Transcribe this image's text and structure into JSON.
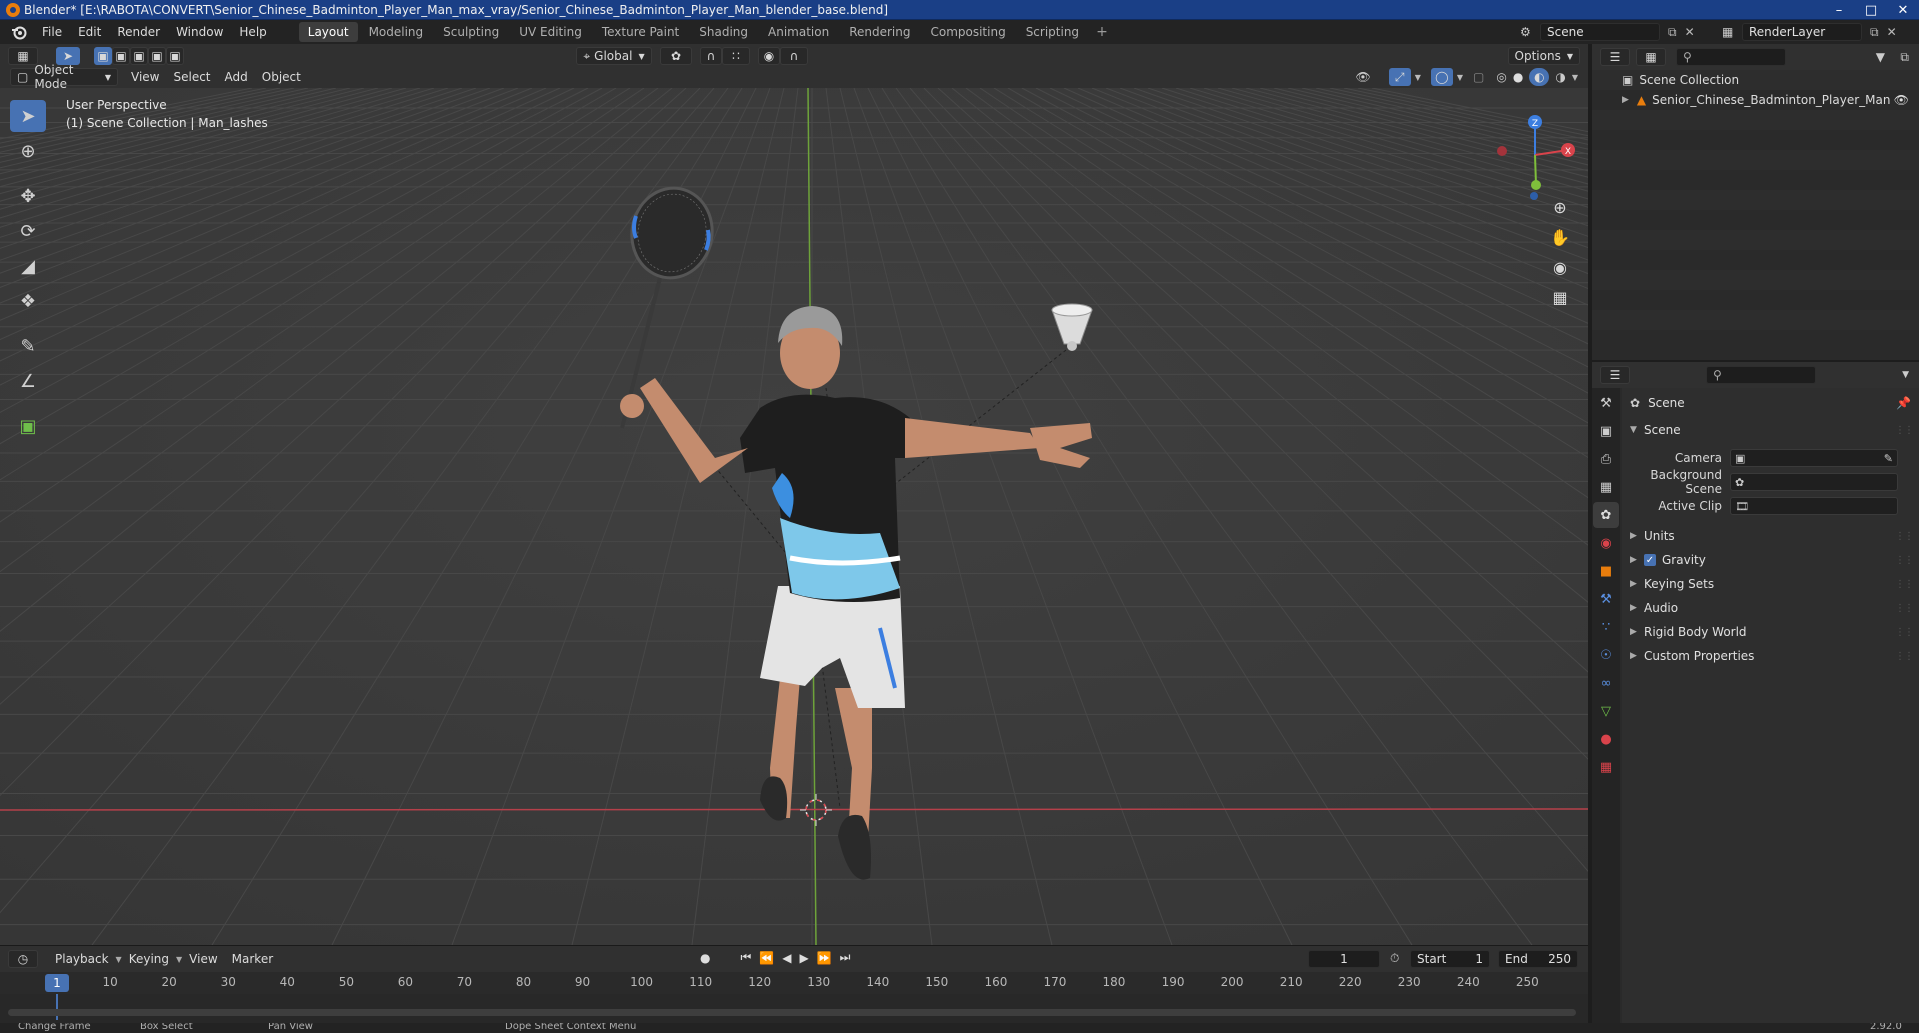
{
  "window": {
    "title": "Blender* [E:\\RABOTA\\CONVERT\\Senior_Chinese_Badminton_Player_Man_max_vray/Senior_Chinese_Badminton_Player_Man_blender_base.blend]",
    "controls": [
      "–",
      "□",
      "✕"
    ]
  },
  "menu": {
    "items": [
      "File",
      "Edit",
      "Render",
      "Window",
      "Help"
    ],
    "workspaces": [
      "Layout",
      "Modeling",
      "Sculpting",
      "UV Editing",
      "Texture Paint",
      "Shading",
      "Animation",
      "Rendering",
      "Compositing",
      "Scripting"
    ],
    "active_workspace": "Layout",
    "add_workspace": "+",
    "scene": "Scene",
    "render_layer": "RenderLayer"
  },
  "viewport_header": {
    "transform_orientation": "Global",
    "options": "Options",
    "mode": "Object Mode",
    "menus": [
      "View",
      "Select",
      "Add",
      "Object"
    ]
  },
  "viewport": {
    "perspective": "User Perspective",
    "collection_info": "(1) Scene Collection | Man_lashes",
    "gizmo_axes": [
      "Z",
      "X"
    ]
  },
  "timeline": {
    "menus": [
      "Playback",
      "Keying",
      "View",
      "Marker"
    ],
    "current_frame": "1",
    "start_label": "Start",
    "start": "1",
    "end_label": "End",
    "end": "250",
    "ticks": [
      "10",
      "20",
      "30",
      "40",
      "50",
      "60",
      "70",
      "80",
      "90",
      "100",
      "110",
      "120",
      "130",
      "140",
      "150",
      "160",
      "170",
      "180",
      "190",
      "200",
      "210",
      "220",
      "230",
      "240",
      "250"
    ],
    "ruler_current": "1"
  },
  "status": {
    "items": [
      "Change Frame",
      "Box Select",
      "Pan View",
      "Dope Sheet Context Menu"
    ],
    "version": "2.92.0"
  },
  "outliner": {
    "root": "Scene Collection",
    "items": [
      "Senior_Chinese_Badminton_Player_Man"
    ]
  },
  "properties": {
    "title": "Scene",
    "panel": "Scene",
    "fields": [
      {
        "label": "Camera",
        "value": ""
      },
      {
        "label": "Background Scene",
        "value": ""
      },
      {
        "label": "Active Clip",
        "value": ""
      }
    ],
    "sections": [
      "Units",
      "Gravity",
      "Keying Sets",
      "Audio",
      "Rigid Body World",
      "Custom Properties"
    ],
    "gravity_checked": true
  },
  "colors": {
    "accent": "#4772b3",
    "x_axis": "#d9434b",
    "y_axis": "#7fbf3b",
    "z_axis": "#3c7ee0",
    "titlebar": "#1a3f86"
  }
}
